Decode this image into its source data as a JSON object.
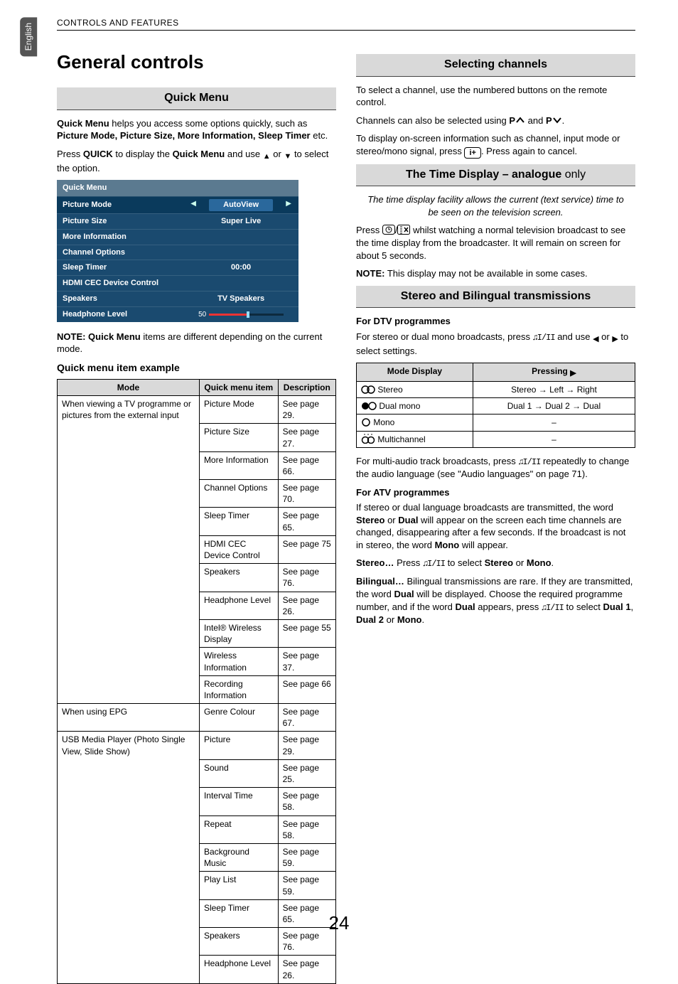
{
  "page_meta": {
    "header": "CONTROLS AND FEATURES",
    "side_tab": "English",
    "page_number": "24"
  },
  "left": {
    "h1": "General controls",
    "quick_menu_bar": "Quick Menu",
    "qm_intro_1a": "Quick Menu",
    "qm_intro_1b": " helps you access some options quickly, such as ",
    "qm_intro_1c": "Picture Mode, Picture Size, More Information, Sleep Timer",
    "qm_intro_1d": " etc.",
    "qm_press_a": "Press ",
    "qm_press_b": "QUICK",
    "qm_press_c": " to display the ",
    "qm_press_d": "Quick Menu",
    "qm_press_e": " and use ",
    "qm_press_f": " or ",
    "qm_press_g": " to select the option.",
    "menushot": {
      "title": "Quick Menu",
      "rows": [
        {
          "label": "Picture Mode",
          "value": "AutoView",
          "pill": true,
          "arrows": true
        },
        {
          "label": "Picture Size",
          "value": "Super Live"
        },
        {
          "label": "More Information",
          "value": ""
        },
        {
          "label": "Channel Options",
          "value": ""
        },
        {
          "label": "Sleep Timer",
          "value": "00:00"
        },
        {
          "label": "HDMI CEC Device Control",
          "value": ""
        },
        {
          "label": "Speakers",
          "value": "TV Speakers"
        },
        {
          "label": "Headphone Level",
          "value": "50",
          "slider": true
        }
      ]
    },
    "qm_note_a": "NOTE: Quick Menu",
    "qm_note_b": " items are different depending on the current mode.",
    "qm_example_h": "Quick menu item example",
    "qm_table": {
      "headers": [
        "Mode",
        "Quick menu item",
        "Description"
      ],
      "groups": [
        {
          "mode": "When viewing a TV programme or pictures from the external input",
          "rows": [
            [
              "Picture Mode",
              "See page 29."
            ],
            [
              "Picture Size",
              "See page 27."
            ],
            [
              "More Information",
              "See page 66."
            ],
            [
              "Channel Options",
              "See page 70."
            ],
            [
              "Sleep Timer",
              "See page 65."
            ],
            [
              "HDMI CEC Device Control",
              "See page 75"
            ],
            [
              "Speakers",
              "See page 76."
            ],
            [
              "Headphone  Level",
              "See page 26."
            ],
            [
              "Intel® Wireless Display",
              "See page 55"
            ],
            [
              "Wireless Information",
              "See page 37."
            ],
            [
              "Recording Information",
              "See page 66"
            ]
          ]
        },
        {
          "mode": "When using EPG",
          "rows": [
            [
              "Genre Colour",
              "See page 67."
            ]
          ]
        },
        {
          "mode": "USB Media Player (Photo Single View, Slide Show)",
          "rows": [
            [
              "Picture",
              "See page 29."
            ],
            [
              "Sound",
              "See page 25."
            ],
            [
              "Interval Time",
              "See page 58."
            ],
            [
              "Repeat",
              "See page 58."
            ],
            [
              "Background Music",
              "See page 59."
            ],
            [
              "Play List",
              "See page 59."
            ],
            [
              "Sleep Timer",
              "See page 65."
            ],
            [
              "Speakers",
              "See page 76."
            ],
            [
              "Headphone  Level",
              "See page 26."
            ]
          ]
        }
      ]
    }
  },
  "right": {
    "sel_bar": "Selecting channels",
    "sel_p1": "To select a channel, use the numbered buttons on the remote control.",
    "sel_p2a": "Channels can also be selected using ",
    "sel_p2b": "P",
    "sel_p2c": " and ",
    "sel_p2d": "P",
    "sel_p2e": ".",
    "sel_p3a": "To display on-screen information such as channel, input mode or stereo/mono signal, press ",
    "sel_p3b": ". Press again to cancel.",
    "info_btn": "i+",
    "time_bar_a": "The Time Display – ",
    "time_bar_b": "analogue",
    "time_bar_c": " only",
    "time_italic": "The time display facility allows the current (text service) time to be seen on the television screen.",
    "time_p1a": "Press ",
    "time_p1b": " whilst watching a normal television broadcast to see the time display from the broadcaster. It will remain on screen for about 5 seconds.",
    "time_note_a": "NOTE:",
    "time_note_b": " This display may not be available in some cases.",
    "stereo_bar": "Stereo and Bilingual transmissions",
    "dtv_h": "For DTV programmes",
    "dtv_p1a": "For stereo or dual mono broadcasts, press ",
    "dtv_p1b": " and use ",
    "dtv_p1c": " or ",
    "dtv_p1d": " to select settings.",
    "mode_table": {
      "headers": [
        "Mode Display",
        "Pressing"
      ],
      "rows": [
        {
          "icon": "stereo",
          "label": "Stereo",
          "pressing": "Stereo → Left → Right"
        },
        {
          "icon": "dualmono",
          "label": "Dual mono",
          "pressing": "Dual 1 → Dual 2 → Dual"
        },
        {
          "icon": "mono",
          "label": "Mono",
          "pressing": "–"
        },
        {
          "icon": "multi",
          "label": "Multichannel",
          "pressing": "–"
        }
      ]
    },
    "dtv_p2a": "For multi-audio track broadcasts, press ",
    "dtv_p2b": " repeatedly to change the audio language (see \"Audio languages\" on page 71).",
    "atv_h": "For ATV programmes",
    "atv_p1a": "If stereo or dual language broadcasts are transmitted, the word ",
    "atv_p1b": "Stereo",
    "atv_p1c": " or ",
    "atv_p1d": "Dual",
    "atv_p1e": " will appear on the screen each time channels are changed, disappearing after a few seconds. If the broadcast is not in stereo, the word ",
    "atv_p1f": "Mono",
    "atv_p1g": " will appear.",
    "atv_s1a": "Stereo…",
    "atv_s1b": " Press ",
    "atv_s1c": " to select ",
    "atv_s1d": "Stereo",
    "atv_s1e": " or ",
    "atv_s1f": "Mono",
    "atv_s1g": ".",
    "atv_b1a": "Bilingual…",
    "atv_b1b": " Bilingual transmissions are rare. If they are transmitted, the word ",
    "atv_b1c": "Dual",
    "atv_b1d": " will be displayed. Choose the required programme number, and if the word ",
    "atv_b1e": "Dual",
    "atv_b1f": " appears, press ",
    "atv_b1g": " to select ",
    "atv_b1h": "Dual 1",
    "atv_b1i": ", ",
    "atv_b1j": "Dual 2",
    "atv_b1k": " or ",
    "atv_b1l": "Mono",
    "atv_b1m": "."
  },
  "glyphs": {
    "arrow_right_long": "→"
  }
}
